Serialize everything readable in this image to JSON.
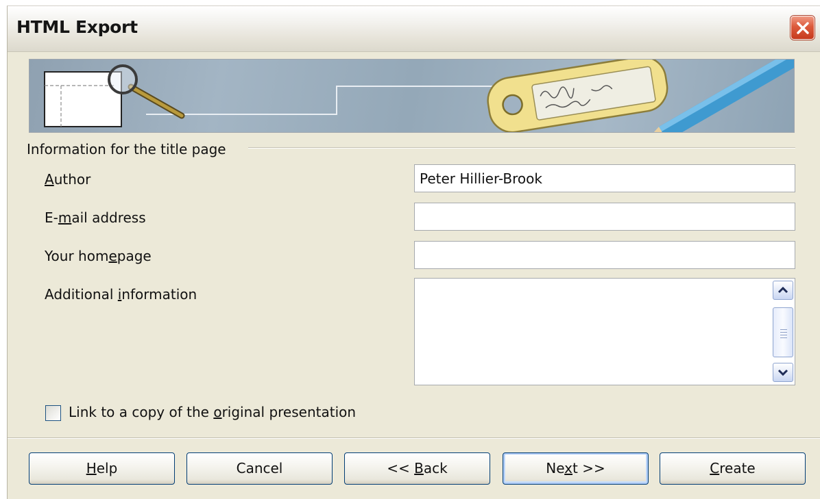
{
  "window": {
    "title": "HTML Export"
  },
  "icons": {
    "close": "close-icon",
    "banner": "banner-illustration",
    "scroll_up": "chevron-up-icon",
    "scroll_down": "chevron-down-icon"
  },
  "group": {
    "title": "Information for the title page"
  },
  "fields": {
    "author": {
      "label_pre": "",
      "label_u": "A",
      "label_post": "uthor",
      "value": "Peter Hillier-Brook"
    },
    "email": {
      "label_pre": "E-",
      "label_u": "m",
      "label_post": "ail address",
      "value": ""
    },
    "homepage": {
      "label_pre": "Your hom",
      "label_u": "e",
      "label_post": "page",
      "value": ""
    },
    "additional": {
      "label_pre": "Additional ",
      "label_u": "i",
      "label_post": "nformation",
      "value": ""
    }
  },
  "checkbox": {
    "label_pre": "Link to a copy of the ",
    "label_u": "o",
    "label_post": "riginal presentation",
    "checked": false
  },
  "buttons": {
    "help": {
      "pre": "",
      "u": "H",
      "post": "elp"
    },
    "cancel": {
      "pre": "Cancel",
      "u": "",
      "post": ""
    },
    "back": {
      "pre": "<< ",
      "u": "B",
      "post": "ack"
    },
    "next": {
      "pre": "Ne",
      "u": "x",
      "post": "t >>"
    },
    "create": {
      "pre": "",
      "u": "C",
      "post": "reate"
    }
  },
  "colors": {
    "dialog_bg": "#ece9d8",
    "close_red": "#dc5a3c",
    "button_border": "#003c74",
    "default_glow": "#aecbf6"
  }
}
